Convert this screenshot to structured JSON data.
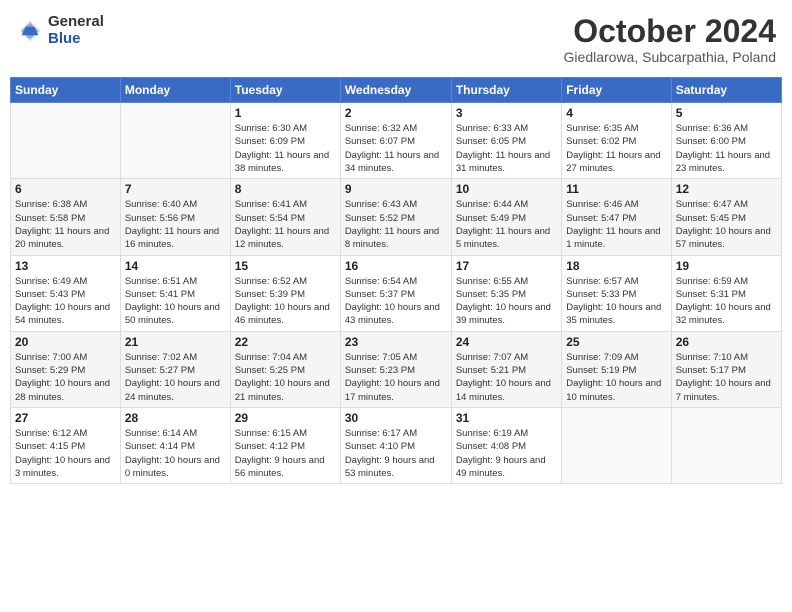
{
  "header": {
    "logo_general": "General",
    "logo_blue": "Blue",
    "month": "October 2024",
    "location": "Giedlarowa, Subcarpathia, Poland"
  },
  "days_of_week": [
    "Sunday",
    "Monday",
    "Tuesday",
    "Wednesday",
    "Thursday",
    "Friday",
    "Saturday"
  ],
  "weeks": [
    [
      {
        "day": "",
        "sunrise": "",
        "sunset": "",
        "daylight": ""
      },
      {
        "day": "",
        "sunrise": "",
        "sunset": "",
        "daylight": ""
      },
      {
        "day": "1",
        "sunrise": "Sunrise: 6:30 AM",
        "sunset": "Sunset: 6:09 PM",
        "daylight": "Daylight: 11 hours and 38 minutes."
      },
      {
        "day": "2",
        "sunrise": "Sunrise: 6:32 AM",
        "sunset": "Sunset: 6:07 PM",
        "daylight": "Daylight: 11 hours and 34 minutes."
      },
      {
        "day": "3",
        "sunrise": "Sunrise: 6:33 AM",
        "sunset": "Sunset: 6:05 PM",
        "daylight": "Daylight: 11 hours and 31 minutes."
      },
      {
        "day": "4",
        "sunrise": "Sunrise: 6:35 AM",
        "sunset": "Sunset: 6:02 PM",
        "daylight": "Daylight: 11 hours and 27 minutes."
      },
      {
        "day": "5",
        "sunrise": "Sunrise: 6:36 AM",
        "sunset": "Sunset: 6:00 PM",
        "daylight": "Daylight: 11 hours and 23 minutes."
      }
    ],
    [
      {
        "day": "6",
        "sunrise": "Sunrise: 6:38 AM",
        "sunset": "Sunset: 5:58 PM",
        "daylight": "Daylight: 11 hours and 20 minutes."
      },
      {
        "day": "7",
        "sunrise": "Sunrise: 6:40 AM",
        "sunset": "Sunset: 5:56 PM",
        "daylight": "Daylight: 11 hours and 16 minutes."
      },
      {
        "day": "8",
        "sunrise": "Sunrise: 6:41 AM",
        "sunset": "Sunset: 5:54 PM",
        "daylight": "Daylight: 11 hours and 12 minutes."
      },
      {
        "day": "9",
        "sunrise": "Sunrise: 6:43 AM",
        "sunset": "Sunset: 5:52 PM",
        "daylight": "Daylight: 11 hours and 8 minutes."
      },
      {
        "day": "10",
        "sunrise": "Sunrise: 6:44 AM",
        "sunset": "Sunset: 5:49 PM",
        "daylight": "Daylight: 11 hours and 5 minutes."
      },
      {
        "day": "11",
        "sunrise": "Sunrise: 6:46 AM",
        "sunset": "Sunset: 5:47 PM",
        "daylight": "Daylight: 11 hours and 1 minute."
      },
      {
        "day": "12",
        "sunrise": "Sunrise: 6:47 AM",
        "sunset": "Sunset: 5:45 PM",
        "daylight": "Daylight: 10 hours and 57 minutes."
      }
    ],
    [
      {
        "day": "13",
        "sunrise": "Sunrise: 6:49 AM",
        "sunset": "Sunset: 5:43 PM",
        "daylight": "Daylight: 10 hours and 54 minutes."
      },
      {
        "day": "14",
        "sunrise": "Sunrise: 6:51 AM",
        "sunset": "Sunset: 5:41 PM",
        "daylight": "Daylight: 10 hours and 50 minutes."
      },
      {
        "day": "15",
        "sunrise": "Sunrise: 6:52 AM",
        "sunset": "Sunset: 5:39 PM",
        "daylight": "Daylight: 10 hours and 46 minutes."
      },
      {
        "day": "16",
        "sunrise": "Sunrise: 6:54 AM",
        "sunset": "Sunset: 5:37 PM",
        "daylight": "Daylight: 10 hours and 43 minutes."
      },
      {
        "day": "17",
        "sunrise": "Sunrise: 6:55 AM",
        "sunset": "Sunset: 5:35 PM",
        "daylight": "Daylight: 10 hours and 39 minutes."
      },
      {
        "day": "18",
        "sunrise": "Sunrise: 6:57 AM",
        "sunset": "Sunset: 5:33 PM",
        "daylight": "Daylight: 10 hours and 35 minutes."
      },
      {
        "day": "19",
        "sunrise": "Sunrise: 6:59 AM",
        "sunset": "Sunset: 5:31 PM",
        "daylight": "Daylight: 10 hours and 32 minutes."
      }
    ],
    [
      {
        "day": "20",
        "sunrise": "Sunrise: 7:00 AM",
        "sunset": "Sunset: 5:29 PM",
        "daylight": "Daylight: 10 hours and 28 minutes."
      },
      {
        "day": "21",
        "sunrise": "Sunrise: 7:02 AM",
        "sunset": "Sunset: 5:27 PM",
        "daylight": "Daylight: 10 hours and 24 minutes."
      },
      {
        "day": "22",
        "sunrise": "Sunrise: 7:04 AM",
        "sunset": "Sunset: 5:25 PM",
        "daylight": "Daylight: 10 hours and 21 minutes."
      },
      {
        "day": "23",
        "sunrise": "Sunrise: 7:05 AM",
        "sunset": "Sunset: 5:23 PM",
        "daylight": "Daylight: 10 hours and 17 minutes."
      },
      {
        "day": "24",
        "sunrise": "Sunrise: 7:07 AM",
        "sunset": "Sunset: 5:21 PM",
        "daylight": "Daylight: 10 hours and 14 minutes."
      },
      {
        "day": "25",
        "sunrise": "Sunrise: 7:09 AM",
        "sunset": "Sunset: 5:19 PM",
        "daylight": "Daylight: 10 hours and 10 minutes."
      },
      {
        "day": "26",
        "sunrise": "Sunrise: 7:10 AM",
        "sunset": "Sunset: 5:17 PM",
        "daylight": "Daylight: 10 hours and 7 minutes."
      }
    ],
    [
      {
        "day": "27",
        "sunrise": "Sunrise: 6:12 AM",
        "sunset": "Sunset: 4:15 PM",
        "daylight": "Daylight: 10 hours and 3 minutes."
      },
      {
        "day": "28",
        "sunrise": "Sunrise: 6:14 AM",
        "sunset": "Sunset: 4:14 PM",
        "daylight": "Daylight: 10 hours and 0 minutes."
      },
      {
        "day": "29",
        "sunrise": "Sunrise: 6:15 AM",
        "sunset": "Sunset: 4:12 PM",
        "daylight": "Daylight: 9 hours and 56 minutes."
      },
      {
        "day": "30",
        "sunrise": "Sunrise: 6:17 AM",
        "sunset": "Sunset: 4:10 PM",
        "daylight": "Daylight: 9 hours and 53 minutes."
      },
      {
        "day": "31",
        "sunrise": "Sunrise: 6:19 AM",
        "sunset": "Sunset: 4:08 PM",
        "daylight": "Daylight: 9 hours and 49 minutes."
      },
      {
        "day": "",
        "sunrise": "",
        "sunset": "",
        "daylight": ""
      },
      {
        "day": "",
        "sunrise": "",
        "sunset": "",
        "daylight": ""
      }
    ]
  ]
}
